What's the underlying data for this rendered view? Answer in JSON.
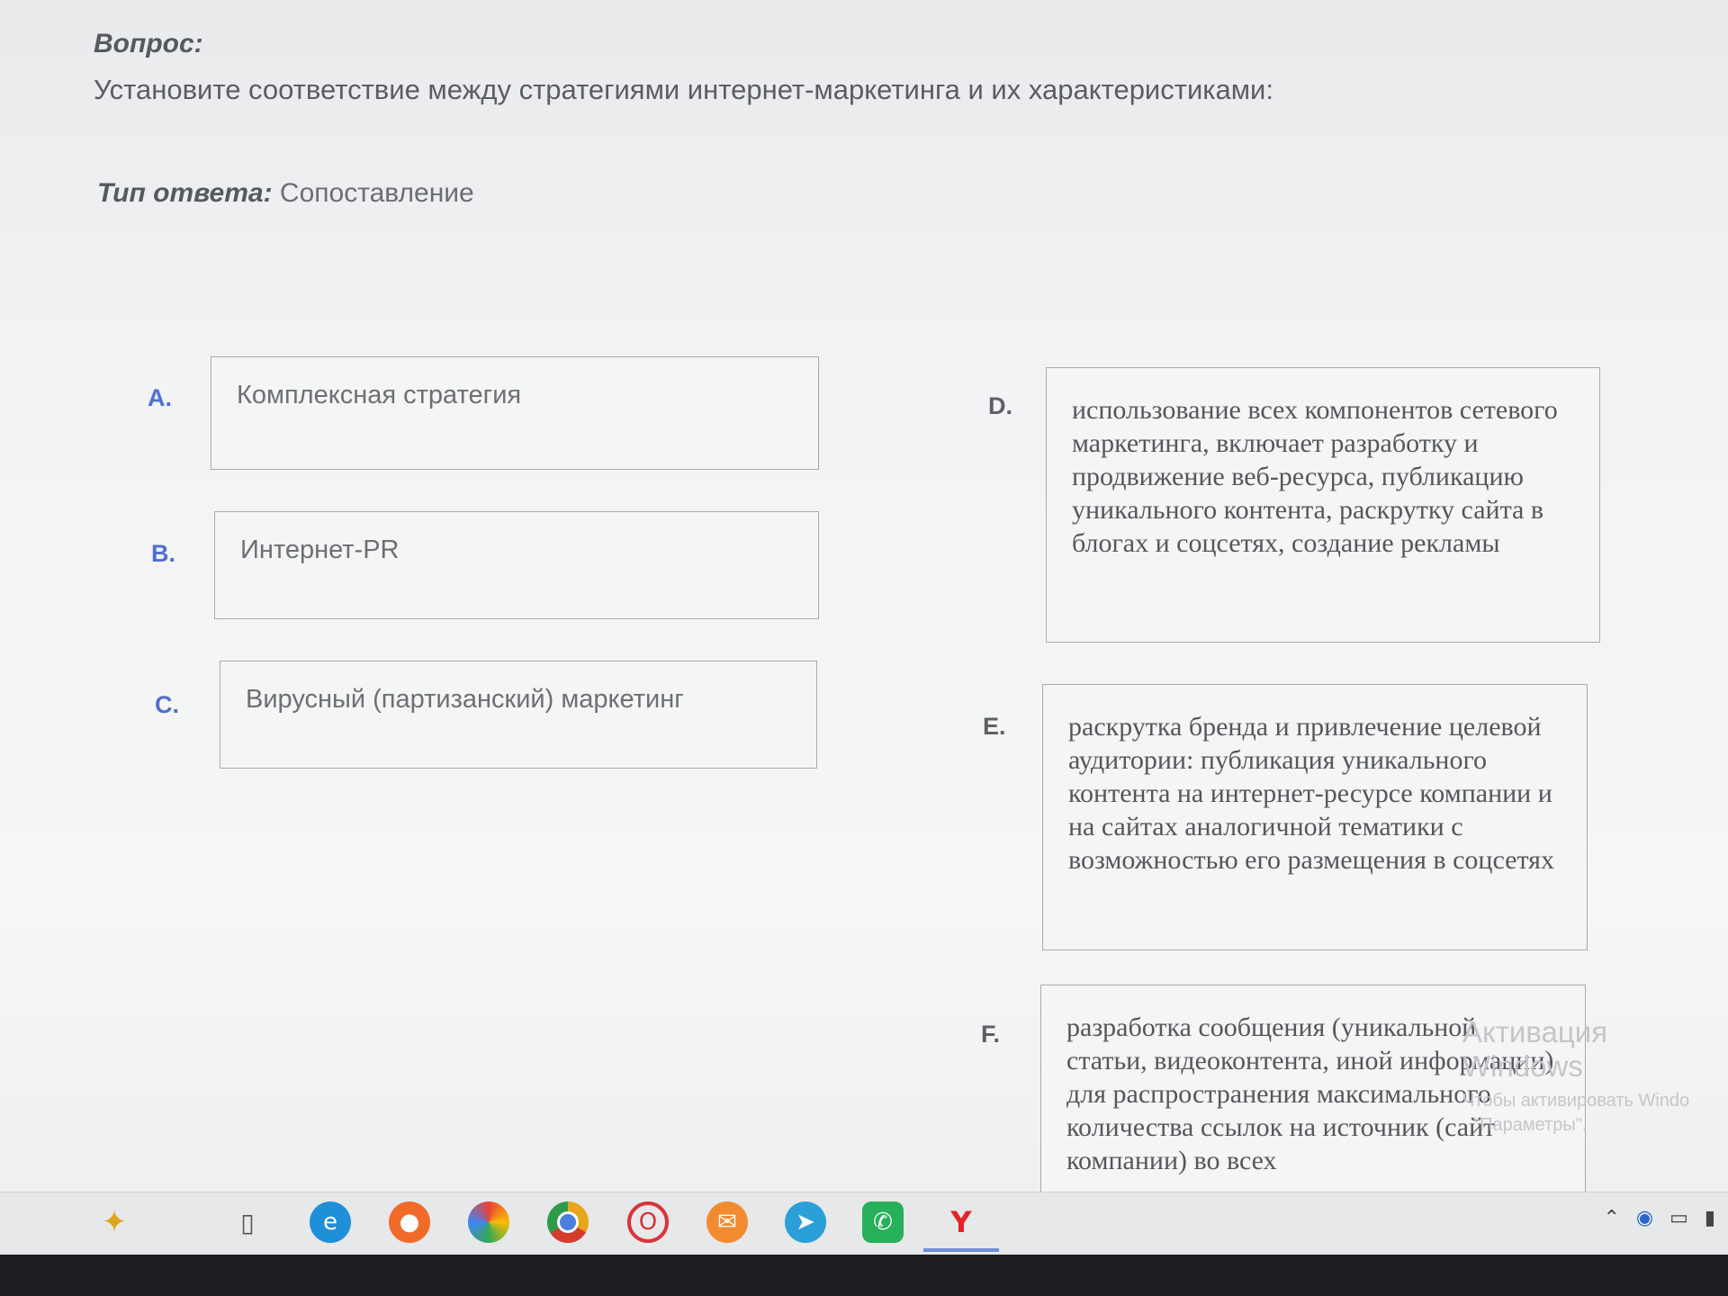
{
  "question": {
    "label": "Вопрос:",
    "text": "Установите соответствие между стратегиями интернет-маркетинга и их характеристиками:"
  },
  "answer_type": {
    "label": "Тип ответа:",
    "value": "Сопоставление"
  },
  "left_items": [
    {
      "letter": "A.",
      "text": "Комплексная стратегия"
    },
    {
      "letter": "B.",
      "text": "Интернет-PR"
    },
    {
      "letter": "C.",
      "text": "Вирусный (партизанский) маркетинг"
    }
  ],
  "right_items": [
    {
      "letter": "D.",
      "text": "использование всех компонентов сетевого маркетинга, включает разработку и продвижение веб-ресурса, публикацию уникального контента, раскрутку сайта в блогах и соцсетях, создание рекламы"
    },
    {
      "letter": "E.",
      "text": "раскрутка бренда и привлечение целевой аудитории: публикация уникального контента на интернет-ресурсе компании и на сайтах аналогичной тематики с возможностью его размещения в соцсетях"
    },
    {
      "letter": "F.",
      "text": "разработка сообщения (уникальной статьи, видеоконтента, иной информации) для распространения максимального количества ссылок на источник (сайт компании) во всех"
    }
  ],
  "watermark": {
    "title": "Активация Windows",
    "line1": "Чтобы активировать Windo",
    "line2": "\"Параметры\"."
  },
  "taskbar": {
    "icons": [
      "copilot-icon",
      "task-view-icon",
      "edge-icon",
      "firefox-icon",
      "browser-icon",
      "chrome-icon",
      "opera-icon",
      "mail-icon",
      "telegram-icon",
      "whatsapp-icon",
      "yandex-icon"
    ],
    "colors": {
      "edge": "#1f8fd8",
      "firefox": "#f06a2a",
      "chrome": "#e5a619",
      "opera": "#d8343b",
      "mail": "#f28b30",
      "telegram": "#2a9fd8",
      "whatsapp": "#26b05a",
      "yandex": "#e2232a"
    }
  }
}
